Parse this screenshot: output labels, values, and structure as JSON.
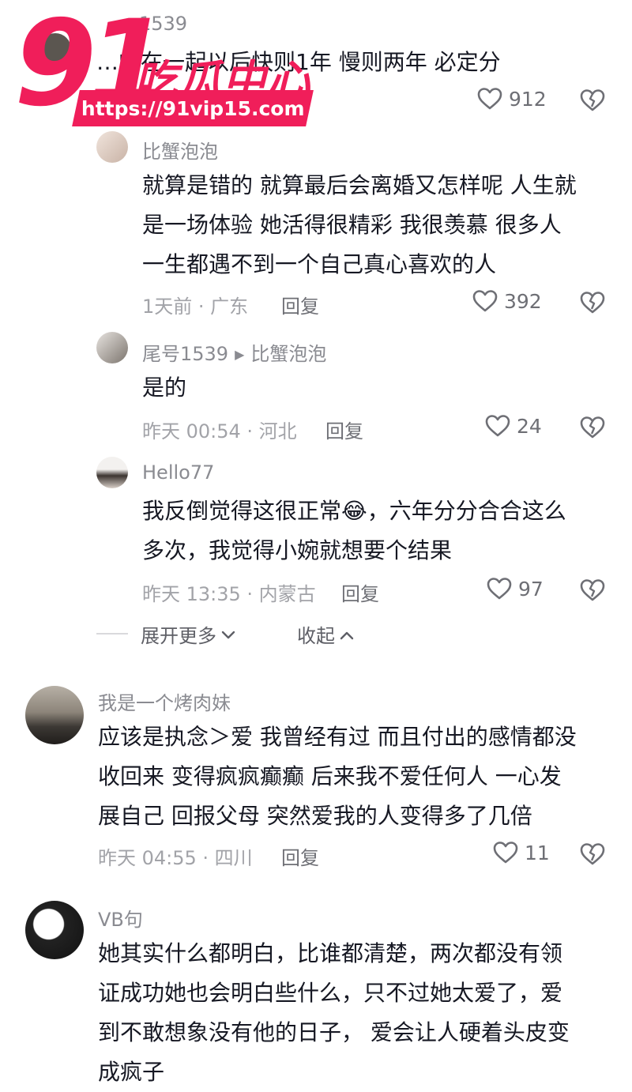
{
  "comments": [
    {
      "username": "1539",
      "text": [
        "…的在一起以后快则1年 慢则两年 必定分"
      ],
      "meta": "",
      "likes": "912"
    },
    {
      "username": "比蟹泡泡",
      "text": [
        "就算是错的 就算最后会离婚又怎样呢 人生就",
        "是一场体验 她活得很精彩 我很羡慕 很多人",
        "一生都遇不到一个自己真心喜欢的人"
      ],
      "meta": "1天前 · 广东",
      "reply": "回复",
      "likes": "392"
    },
    {
      "username": "尾号1539",
      "reply_to": "比蟹泡泡",
      "text": [
        "是的"
      ],
      "meta": "昨天 00:54 · 河北",
      "reply": "回复",
      "likes": "24"
    },
    {
      "username": "Hello77",
      "text": [
        "我反倒觉得这很正常😂，六年分分合合这么",
        "多次，我觉得小婉就想要个结果"
      ],
      "meta": "昨天 13:35 · 内蒙古",
      "reply": "回复",
      "likes": "97"
    },
    {
      "username": "我是一个烤肉妹",
      "text": [
        "应该是执念＞爱 我曾经有过 而且付出的感情都没",
        "收回来 变得疯疯癫癫 后来我不爱任何人 一心发",
        "展自己 回报父母 突然爱我的人变得多了几倍"
      ],
      "meta": "昨天 04:55 · 四川",
      "reply": "回复",
      "likes": "11"
    },
    {
      "username": "VB句",
      "text": [
        "她其实什么都明白，比谁都清楚，两次都没有领",
        "证成功她也会明白些什么，只不过她太爱了，爱",
        "到不敢想象没有他的日子， 爱会让人硬着头皮变",
        "成疯子"
      ]
    }
  ],
  "thread_controls": {
    "expand": "展开更多",
    "collapse": "收起"
  },
  "watermark": {
    "number": "91",
    "title": "吃瓜中心",
    "url": "https://91vip15.com"
  },
  "colors": {
    "brand": "#f01e5a",
    "text": "#161823",
    "meta": "#a2a3a8"
  },
  "icons": {
    "like": "heart-icon",
    "dislike": "broken-heart-icon",
    "expand": "chevron-down-icon",
    "collapse": "chevron-up-icon"
  }
}
